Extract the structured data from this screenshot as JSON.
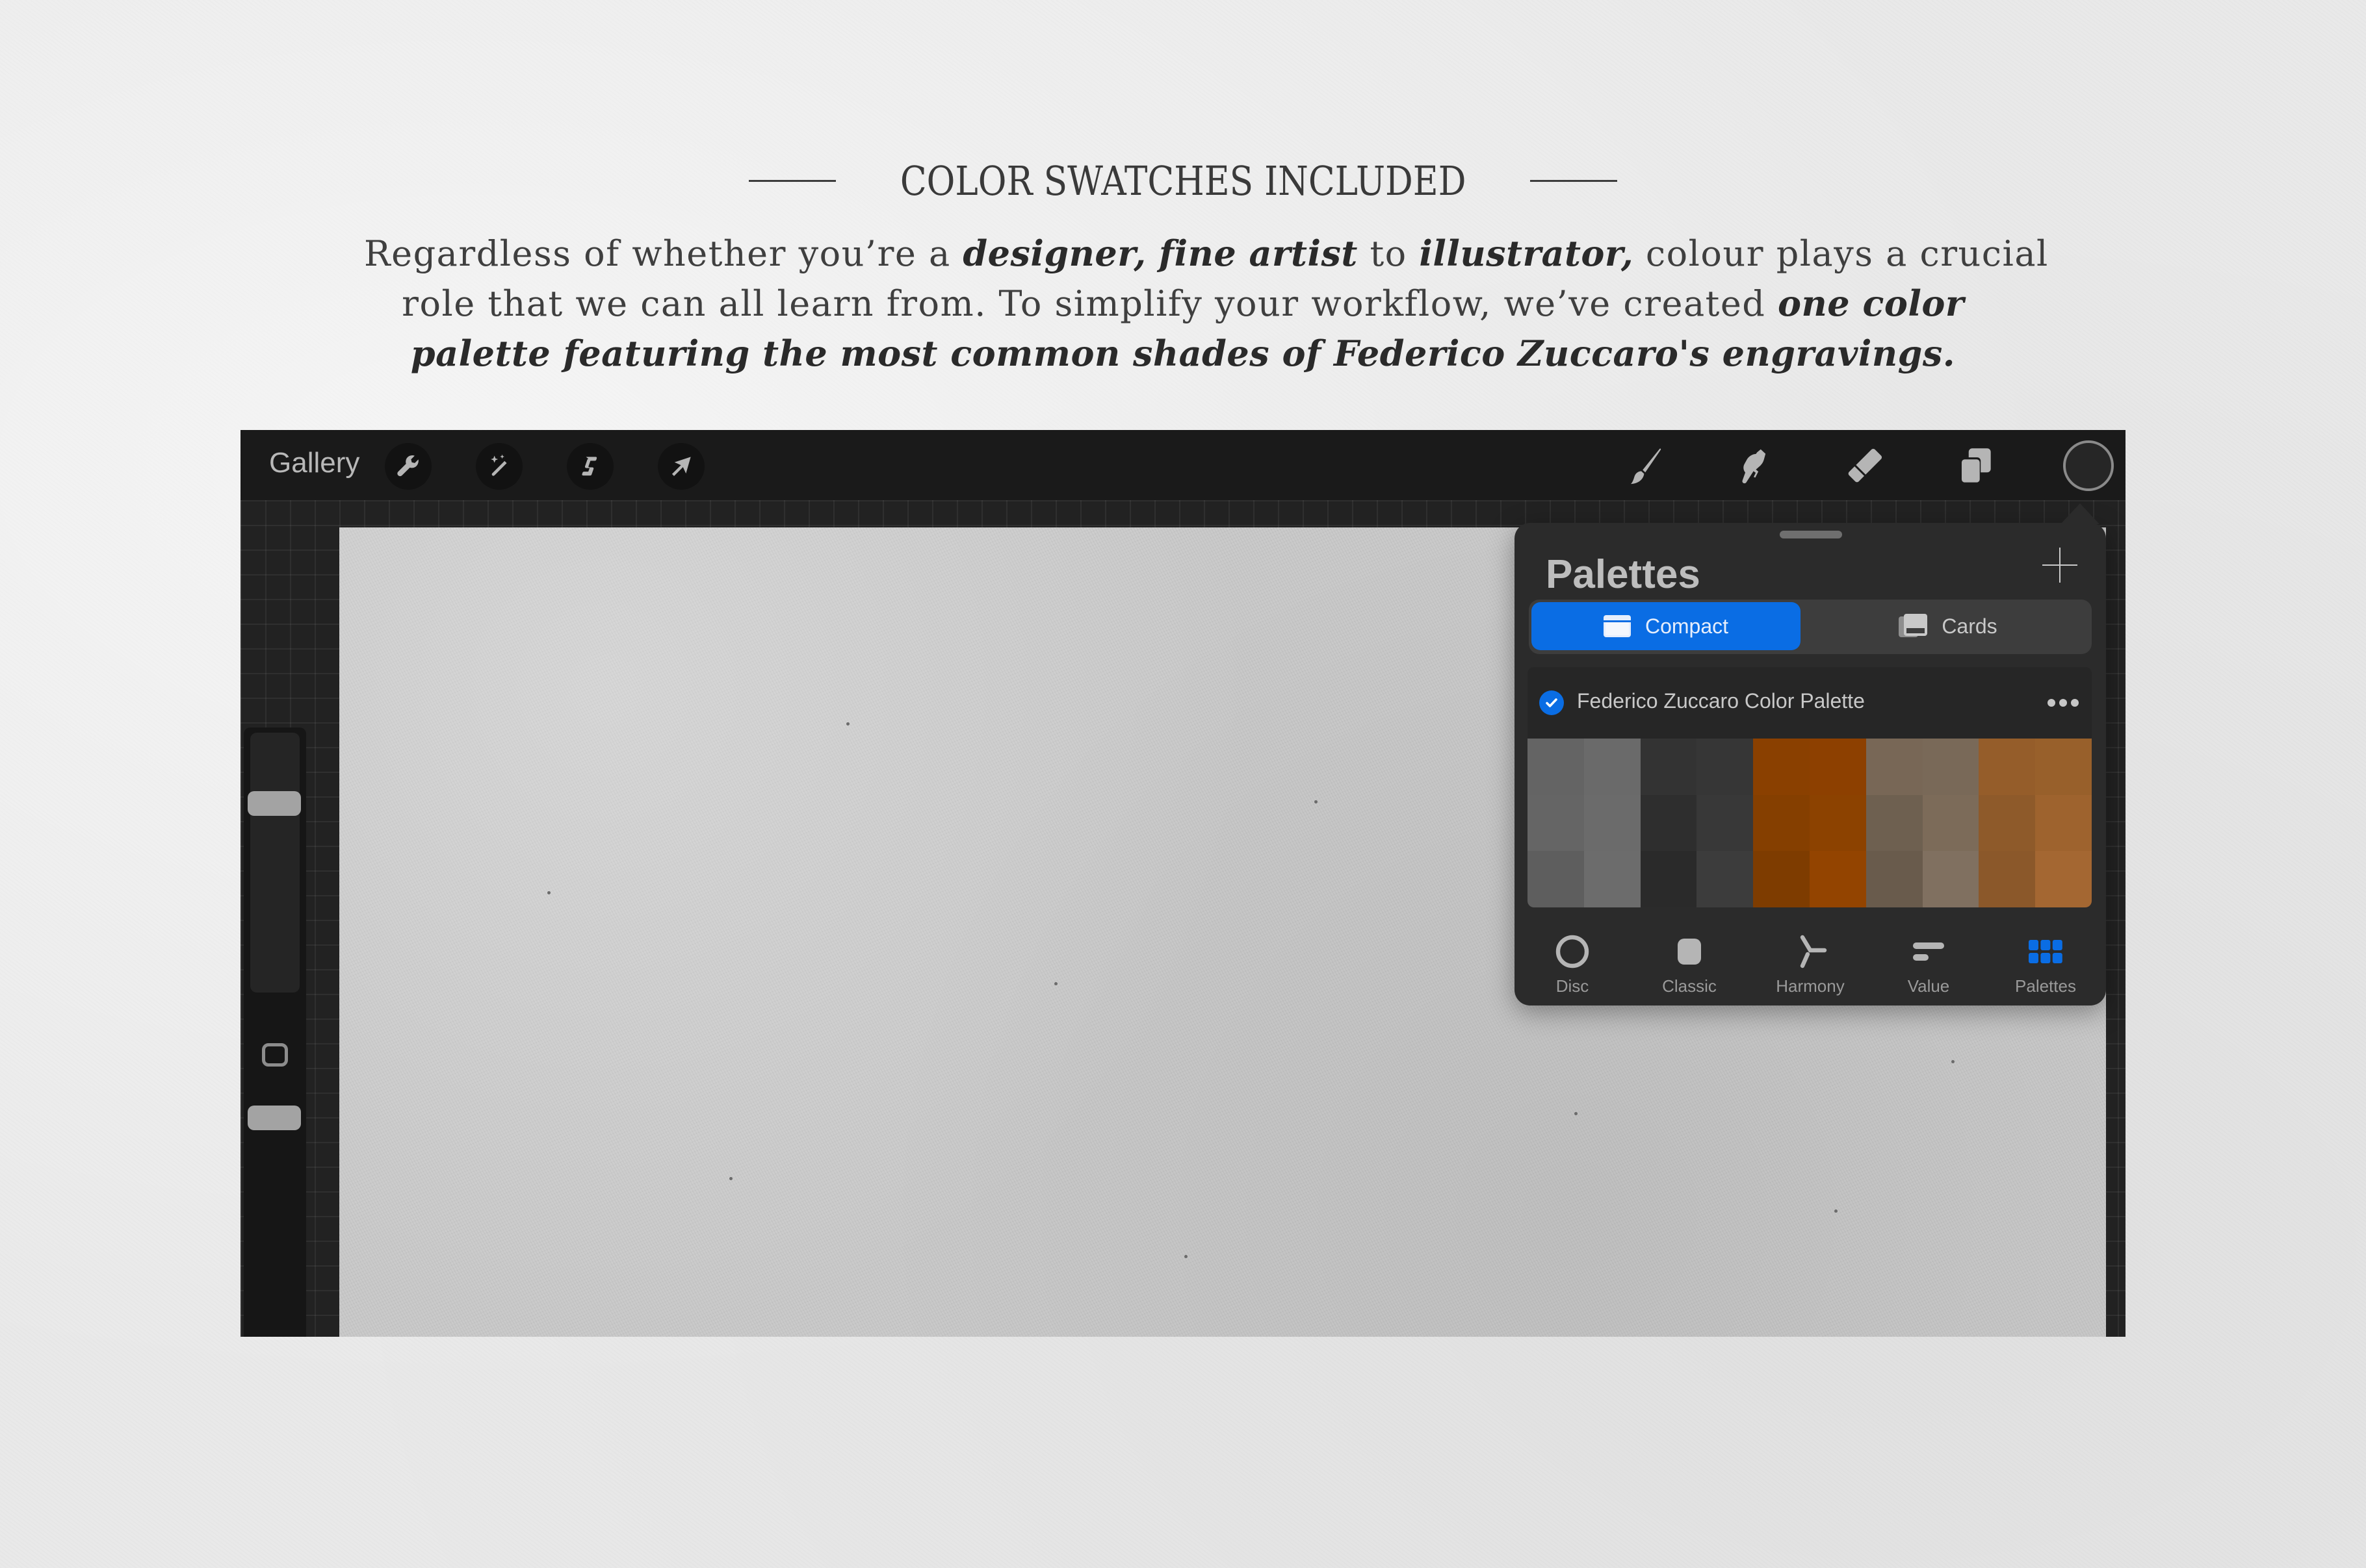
{
  "heading": {
    "title": "COLOR SWATCHES INCLUDED"
  },
  "intro": {
    "line1": [
      {
        "text": "Regardless of whether you’re a ",
        "emphasis": false
      },
      {
        "text": "designer, fine artist",
        "emphasis": true
      },
      {
        "text": " to ",
        "emphasis": false
      },
      {
        "text": "illustrator,",
        "emphasis": true
      },
      {
        "text": " colour plays a crucial",
        "emphasis": false
      }
    ],
    "line2": [
      {
        "text": "role that we can all learn from. To simplify your workflow, we’ve created ",
        "emphasis": false
      },
      {
        "text": "one color",
        "emphasis": true
      }
    ],
    "line3": [
      {
        "text": "palette featuring the most common shades of Federico Zuccaro's engravings.",
        "emphasis": true
      }
    ]
  },
  "toolbar": {
    "gallery_label": "Gallery",
    "left_tools": [
      {
        "name": "actions",
        "icon": "wrench-icon"
      },
      {
        "name": "adjustments",
        "icon": "magic-wand-icon"
      },
      {
        "name": "selection",
        "icon": "selection-s-icon"
      },
      {
        "name": "transform",
        "icon": "arrow-cursor-icon"
      }
    ],
    "right_tools": [
      {
        "name": "brush",
        "icon": "brush-icon"
      },
      {
        "name": "smudge",
        "icon": "smudge-finger-icon"
      },
      {
        "name": "eraser",
        "icon": "eraser-icon"
      },
      {
        "name": "layers",
        "icon": "layers-icon"
      }
    ],
    "current_color": "#262626"
  },
  "palettes_panel": {
    "title": "Palettes",
    "add_label": "+",
    "view_modes": [
      {
        "label": "Compact",
        "active": true,
        "icon": "compact-view-icon"
      },
      {
        "label": "Cards",
        "active": false,
        "icon": "cards-view-icon"
      }
    ],
    "palette": {
      "name": "Federico Zuccaro Color Palette",
      "is_default": true,
      "swatches": [
        [
          "#646464",
          "#6a6a6a",
          "#333333",
          "#363636",
          "#8a4000",
          "#8d4000",
          "#786756",
          "#796958",
          "#955d2a",
          "#98602b"
        ],
        [
          "#656565",
          "#6b6b6b",
          "#2e2e2e",
          "#383838",
          "#853f00",
          "#8c4200",
          "#6e6050",
          "#7c6b59",
          "#8e5a2a",
          "#9e632e"
        ],
        [
          "#5e5e5e",
          "#6c6c6c",
          "#2a2a2a",
          "#3c3c3c",
          "#7e3c00",
          "#934400",
          "#695b4c",
          "#807060",
          "#8b582a",
          "#a46732"
        ]
      ]
    },
    "tabs": [
      {
        "label": "Disc",
        "icon": "disc-icon",
        "active": false
      },
      {
        "label": "Classic",
        "icon": "classic-square-icon",
        "active": false
      },
      {
        "label": "Harmony",
        "icon": "harmony-icon",
        "active": false
      },
      {
        "label": "Value",
        "icon": "value-sliders-icon",
        "active": false
      },
      {
        "label": "Palettes",
        "icon": "palettes-grid-icon",
        "active": true
      }
    ]
  },
  "colors": {
    "accent": "#0a6de4",
    "inactive_icon": "#b5b5b5",
    "active_tab": "#0a6de4"
  }
}
